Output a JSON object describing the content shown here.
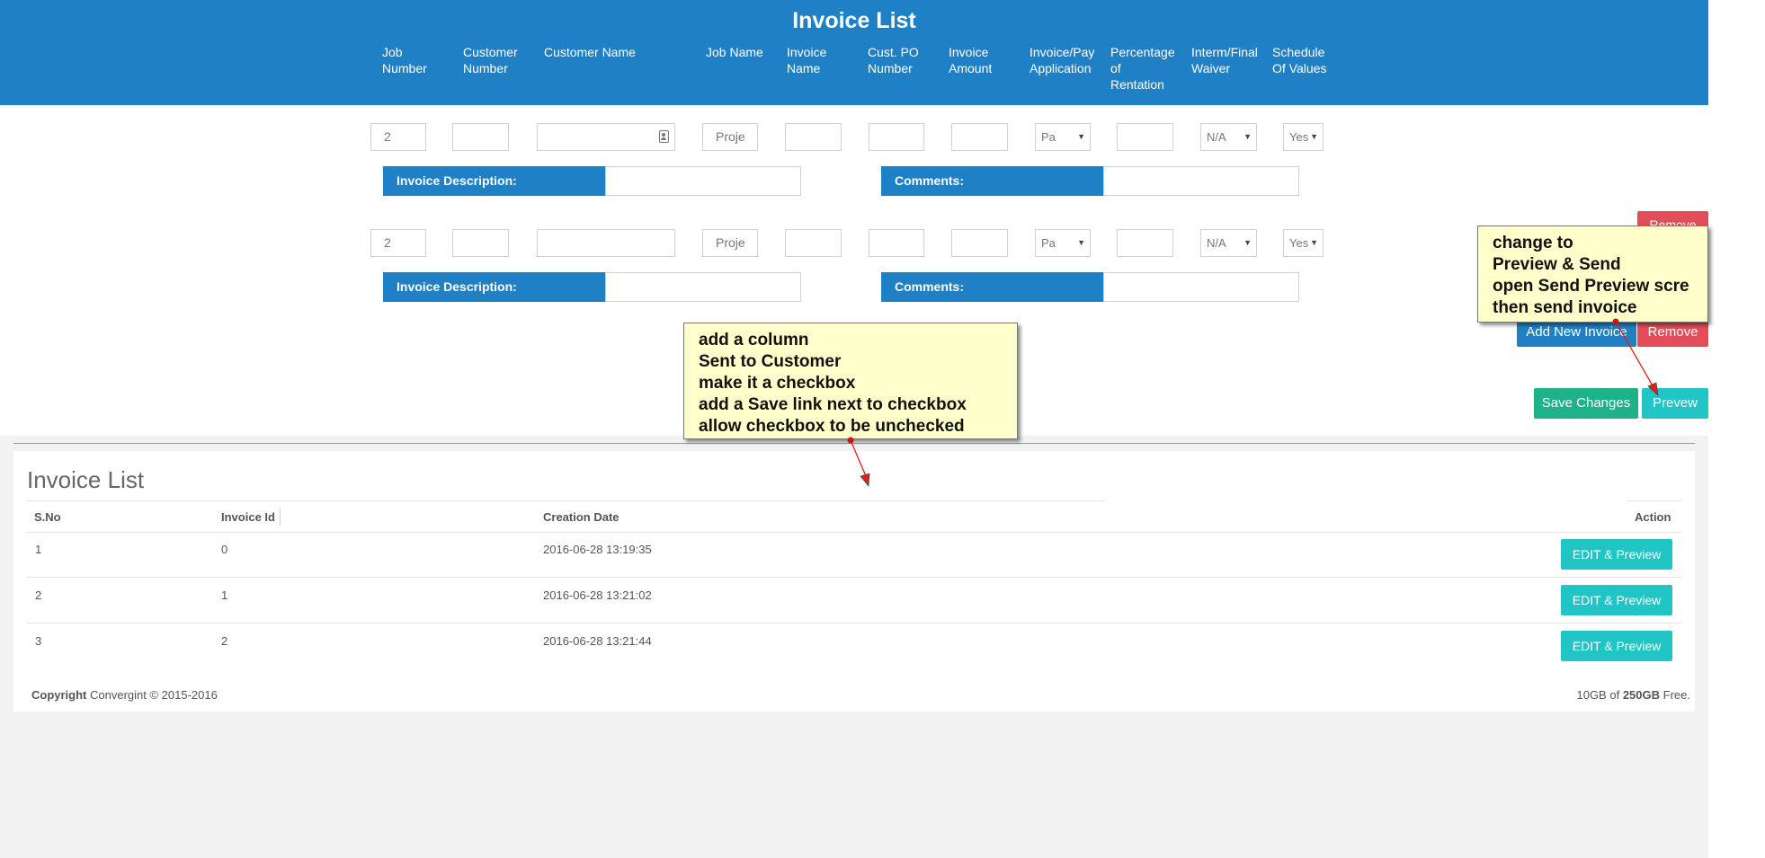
{
  "header": {
    "title": "Invoice List",
    "columns": [
      [
        "Job",
        "Number"
      ],
      [
        "Customer",
        "Number"
      ],
      [
        "Customer Name"
      ],
      [
        "Job Name"
      ],
      [
        "Invoice",
        "Name"
      ],
      [
        "Cust. PO",
        "Number"
      ],
      [
        "Invoice",
        "Amount"
      ],
      [
        "Invoice/Pay",
        "Application"
      ],
      [
        "Percentage",
        "of",
        "Rentation"
      ],
      [
        "Interm/Final",
        "Waiver"
      ],
      [
        "Schedule",
        "Of Values"
      ]
    ]
  },
  "rows": [
    {
      "job_number": "2",
      "job_name": "Proje",
      "pay_application": "Pa",
      "waiver": "N/A",
      "schedule": "Yes",
      "description_label": "Invoice Description:",
      "comments_label": "Comments:"
    },
    {
      "job_number": "2",
      "job_name": "Proje",
      "pay_application": "Pa",
      "waiver": "N/A",
      "schedule": "Yes",
      "description_label": "Invoice Description:",
      "comments_label": "Comments:"
    }
  ],
  "buttons": {
    "remove_top": "Remove",
    "add_new_invoice": "Add New Invoice",
    "remove": "Remove",
    "save_changes": "Save Changes",
    "preview": "Prevew"
  },
  "invoice_list": {
    "title": "Invoice List",
    "columns": [
      "S.No",
      "Invoice Id",
      "Creation Date",
      "Action"
    ],
    "rows": [
      {
        "sno": "1",
        "invoice_id": "0",
        "created": "2016-06-28 13:19:35",
        "action": "EDIT & Preview"
      },
      {
        "sno": "2",
        "invoice_id": "1",
        "created": "2016-06-28 13:21:02",
        "action": "EDIT & Preview"
      },
      {
        "sno": "3",
        "invoice_id": "2",
        "created": "2016-06-28 13:21:44",
        "action": "EDIT & Preview"
      }
    ]
  },
  "footer": {
    "copyright_label": "Copyright",
    "copyright_text": "Convergint © 2015-2016",
    "storage_used": "10GB",
    "storage_of": "of",
    "storage_total": "250GB",
    "storage_free": "Free."
  },
  "annotations": {
    "note_column": [
      "add a column",
      "Sent to Customer",
      "make it a checkbox",
      "add a Save link next to checkbox",
      "allow checkbox to be unchecked"
    ],
    "note_preview": [
      "change to",
      "Preview & Send",
      "open Send Preview scre",
      "then send invoice"
    ]
  },
  "colors": {
    "header_blue": "#1f80c6",
    "remove_red": "#e24d5a",
    "save_green": "#1fb18a",
    "preview_teal": "#22c5c5",
    "note_yellow": "#ffffcc",
    "arrow_red": "#e0211b"
  }
}
